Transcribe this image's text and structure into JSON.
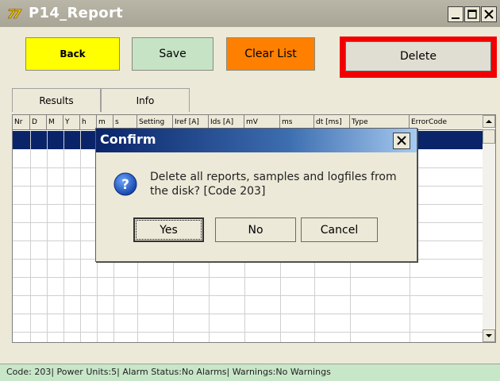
{
  "window": {
    "title": "P14_Report"
  },
  "toolbar": {
    "back_label": "Back",
    "save_label": "Save",
    "clear_label": "Clear List",
    "delete_label": "Delete",
    "colors": {
      "back": "#ffff00",
      "save": "#c6e3c6",
      "clear": "#ff8000",
      "delete_highlight": "#f00000"
    }
  },
  "tabs": [
    {
      "label": "Results"
    },
    {
      "label": "Info"
    }
  ],
  "grid": {
    "columns": [
      "Nr",
      "D",
      "M",
      "Y",
      "h",
      "m",
      "s",
      "Setting",
      "Iref [A]",
      "Ids [A]",
      "mV",
      "ms",
      "dt [ms]",
      "Type",
      "ErrorCode"
    ],
    "selected_row_color": "#0a246a"
  },
  "dialog": {
    "title": "Confirm",
    "icon": "question-icon",
    "message": "Delete all reports, samples and logfiles from the disk? [Code 203]",
    "yes_label": "Yes",
    "no_label": "No",
    "cancel_label": "Cancel"
  },
  "status": {
    "text": "Code: 203| Power Units:5| Alarm Status:No Alarms| Warnings:No Warnings"
  }
}
